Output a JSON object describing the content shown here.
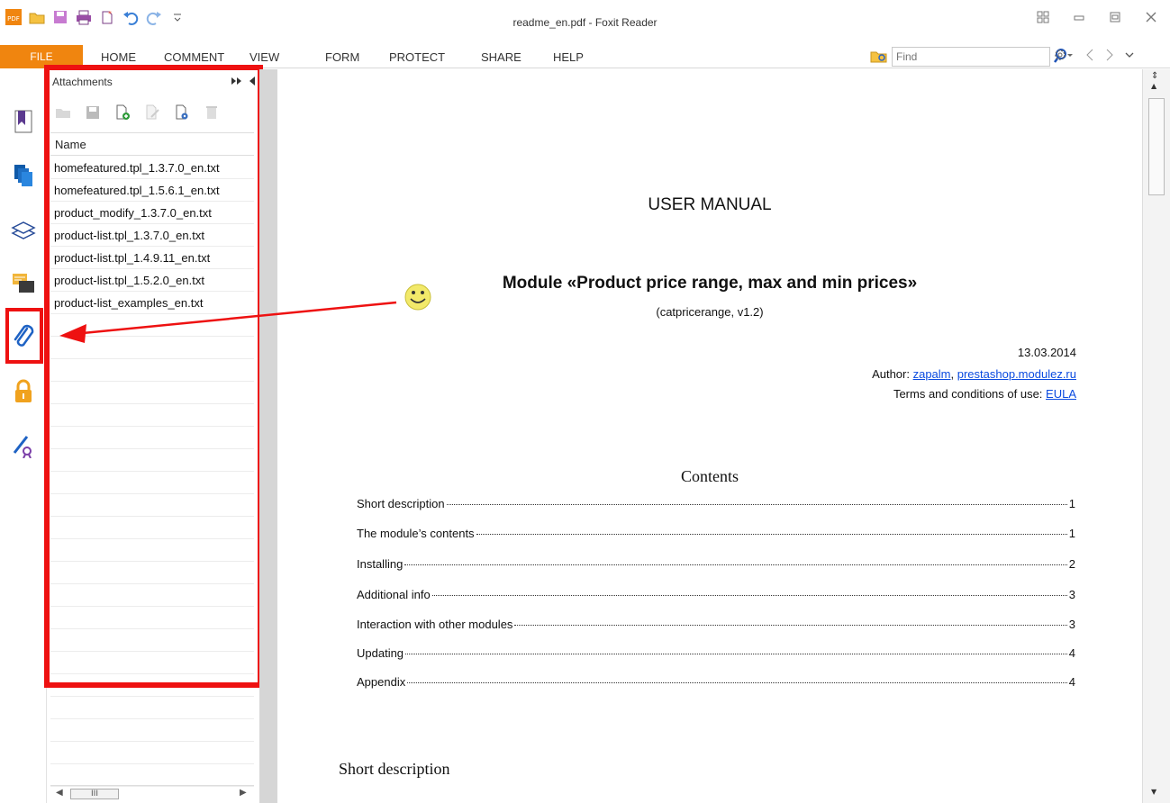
{
  "window": {
    "title": "readme_en.pdf - Foxit Reader",
    "controls": [
      "restore-grid",
      "minimize",
      "maximize",
      "close"
    ]
  },
  "menu": {
    "file": "FILE",
    "items": [
      "HOME",
      "COMMENT",
      "VIEW",
      "FORM",
      "PROTECT",
      "SHARE",
      "HELP"
    ]
  },
  "search": {
    "placeholder": "Find"
  },
  "attachments_panel": {
    "title": "Attachments",
    "column_header": "Name",
    "files": [
      "homefeatured.tpl_1.3.7.0_en.txt",
      "homefeatured.tpl_1.5.6.1_en.txt",
      "product_modify_1.3.7.0_en.txt",
      "product-list.tpl_1.3.7.0_en.txt",
      "product-list.tpl_1.4.9.11_en.txt",
      "product-list.tpl_1.5.2.0_en.txt",
      "product-list_examples_en.txt"
    ],
    "scroll_thumb": "III"
  },
  "rail_icons": [
    "bookmark-icon",
    "pages-icon",
    "layers-icon",
    "comments-icon",
    "attachment-icon",
    "security-icon",
    "signature-icon"
  ],
  "document": {
    "heading": "USER MANUAL",
    "title": "Module «Product price range, max and min prices»",
    "subtitle": "(catpricerange, v1.2)",
    "date": "13.03.2014",
    "author_label": "Author: ",
    "author_link1": "zapalm",
    "author_sep": ", ",
    "author_link2": "prestashop.modulez.ru",
    "terms_label": "Terms and conditions of use: ",
    "terms_link": "EULA",
    "toc_heading": "Contents",
    "toc": [
      {
        "label": "Short description",
        "page": "1"
      },
      {
        "label": "The module’s contents",
        "page": "1"
      },
      {
        "label": "Installing",
        "page": "2"
      },
      {
        "label": "Additional info",
        "page": "3"
      },
      {
        "label": "Interaction with other modules",
        "page": "3"
      },
      {
        "label": "Updating",
        "page": "4"
      },
      {
        "label": "Appendix",
        "page": "4"
      }
    ],
    "section_heading": "Short description"
  },
  "colors": {
    "file_tab": "#f0850f",
    "highlight": "#ee1111",
    "link": "#0b4be0",
    "smiley": "#f2e96a"
  }
}
